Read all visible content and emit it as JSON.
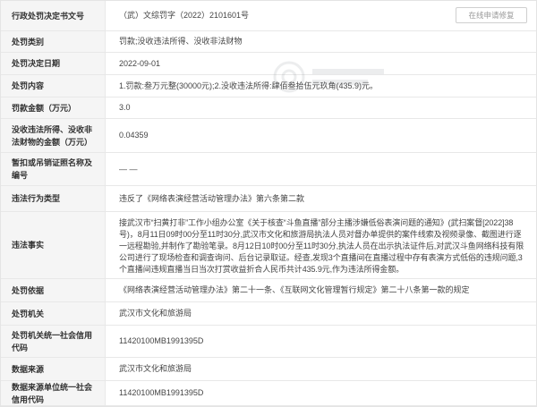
{
  "actions": {
    "repair_button": "在线申请修复"
  },
  "rows": [
    {
      "label": "行政处罚决定书文号",
      "value": "（武）文综罚字（2022）2101601号"
    },
    {
      "label": "处罚类别",
      "value": "罚款;没收违法所得、没收非法财物"
    },
    {
      "label": "处罚决定日期",
      "value": "2022-09-01"
    },
    {
      "label": "处罚内容",
      "value": "1.罚款:叁万元整(30000元);2.没收违法所得:肆佰叁拾伍元玖角(435.9)元。"
    },
    {
      "label": "罚款金额（万元）",
      "value": "3.0"
    },
    {
      "label": "没收违法所得、没收非法财物的金额（万元）",
      "value": "0.04359"
    },
    {
      "label": "暂扣或吊销证照名称及编号",
      "value": "— —"
    },
    {
      "label": "违法行为类型",
      "value": "违反了《网络表演经营活动管理办法》第六条第二款"
    },
    {
      "label": "违法事实",
      "value": "接武汉市“扫黄打非”工作小组办公室《关于核查“斗鱼直播”部分主播涉嫌低俗表演问题的通知》(武扫案督[2022]38号)，8月11日09时00分至11时30分,武汉市文化和旅游局执法人员对督办单提供的案件线索及视频录像、截图进行逐一远程勘验,并制作了勘验笔录。8月12日10时00分至11时30分,执法人员在出示执法证件后,对武汉斗鱼网络科技有限公司进行了现场检查和调查询问、后台记录取证。经查,发现3个直播间在直播过程中存有表演方式低俗的违规问题,3个直播间违规直播当日当次打赏收益折合人民币共计435.9元,作为违法所得金额。"
    },
    {
      "label": "处罚依据",
      "value": "《网络表演经营活动管理办法》第二十一条、《互联网文化管理暂行规定》第二十八条第一款的规定"
    },
    {
      "label": "处罚机关",
      "value": "武汉市文化和旅游局"
    },
    {
      "label": "处罚机关统一社会信用代码",
      "value": "11420100MB1991395D"
    },
    {
      "label": "数据来源",
      "value": "武汉市文化和旅游局"
    },
    {
      "label": "数据来源单位统一社会信用代码",
      "value": "11420100MB1991395D"
    }
  ]
}
